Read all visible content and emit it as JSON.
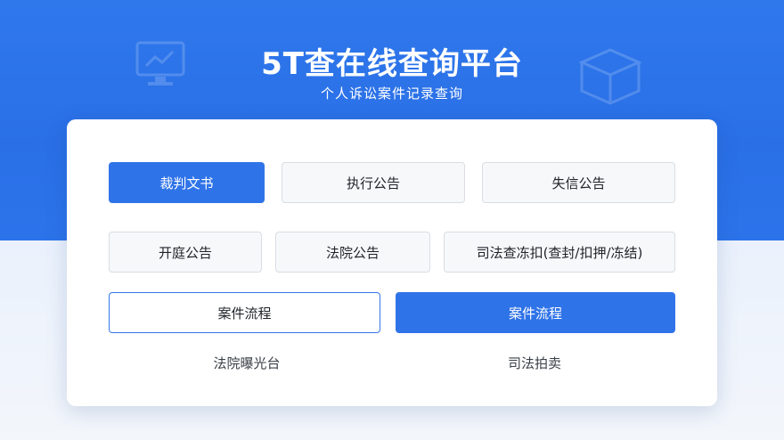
{
  "header": {
    "title": "5T查在线查询平台",
    "subtitle": "个人诉讼案件记录查询"
  },
  "buttons": {
    "row1": [
      "裁判文书",
      "执行公告",
      "失信公告"
    ],
    "row2": [
      "开庭公告",
      "法院公告",
      "司法查冻扣(查封/扣押/冻结)"
    ],
    "row3": [
      "案件流程",
      "案件流程"
    ]
  },
  "links": [
    "法院曝光台",
    "司法拍卖"
  ],
  "colors": {
    "primary": "#2f73e8",
    "hero_background": "#2c73ea",
    "button_border": "#d9dde3"
  },
  "icons": {
    "left_decoration": "monitor-chart-icon",
    "right_decoration": "cube-box-icon"
  }
}
